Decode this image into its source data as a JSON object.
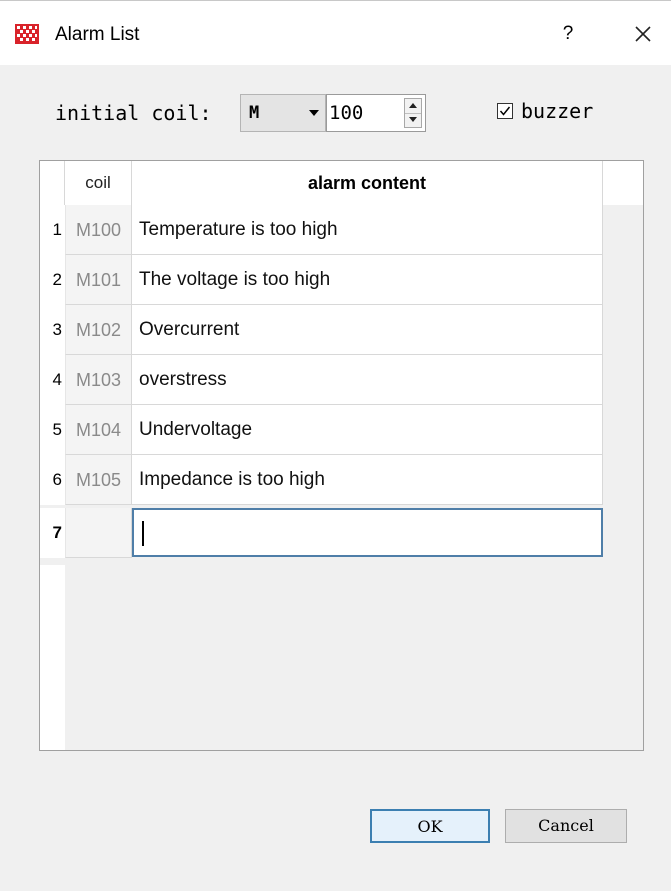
{
  "window": {
    "title": "Alarm List",
    "help_glyph": "?",
    "close_icon": "close-icon",
    "app_icon": "grid-app-icon",
    "accent": "#d9232a"
  },
  "settings": {
    "initial_coil_label": "initial coil:",
    "coil_type": "M",
    "coil_start": "100",
    "buzzer_label": "buzzer",
    "buzzer_checked": true
  },
  "table": {
    "headers": {
      "coil": "coil",
      "content": "alarm content"
    },
    "rows": [
      {
        "num": "1",
        "coil": "M100",
        "content": "Temperature is too high"
      },
      {
        "num": "2",
        "coil": "M101",
        "content": "The voltage is too high"
      },
      {
        "num": "3",
        "coil": "M102",
        "content": "Overcurrent"
      },
      {
        "num": "4",
        "coil": "M103",
        "content": "overstress"
      },
      {
        "num": "5",
        "coil": "M104",
        "content": "Undervoltage"
      },
      {
        "num": "6",
        "coil": "M105",
        "content": "Impedance is too high"
      }
    ],
    "edit_row": {
      "num": "7",
      "coil": "",
      "content": ""
    }
  },
  "buttons": {
    "ok": "OK",
    "cancel": "Cancel"
  }
}
